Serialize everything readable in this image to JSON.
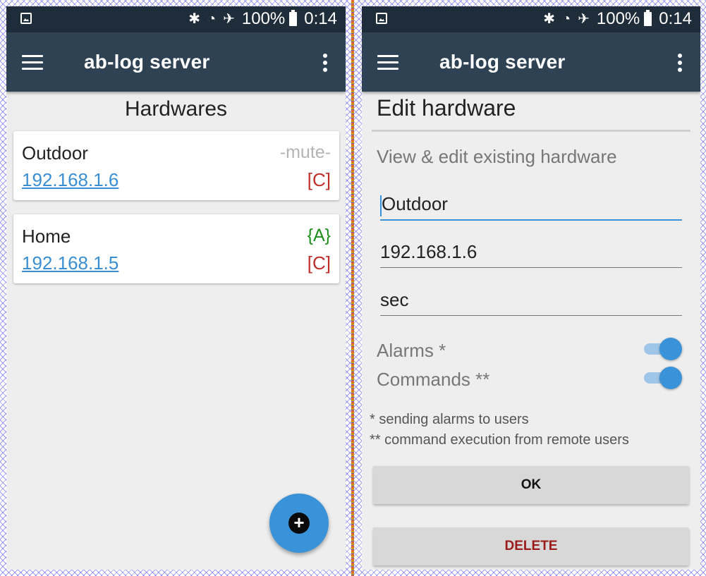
{
  "status_bar": {
    "battery": "100%",
    "time": "0:14"
  },
  "app": {
    "title": "ab-log server"
  },
  "list_screen": {
    "heading": "Hardwares",
    "hardwares": [
      {
        "name": "Outdoor",
        "ip": "192.168.1.6",
        "alarm_state": "-mute-",
        "mode": "[C]"
      },
      {
        "name": "Home",
        "ip": "192.168.1.5",
        "alarm_state": "{A}",
        "mode": "[C]"
      }
    ]
  },
  "edit_screen": {
    "title": "Edit hardware",
    "subtitle": "View & edit existing hardware",
    "fields": {
      "name": "Outdoor",
      "ip": "192.168.1.6",
      "password": "sec"
    },
    "switches": {
      "alarms_label": "Alarms *",
      "alarms_on": true,
      "commands_label": "Commands **",
      "commands_on": true
    },
    "notes": [
      "* sending alarms to users",
      "** command execution from remote users"
    ],
    "ok_label": "OK",
    "delete_label": "DELETE"
  },
  "colors": {
    "appbar": "#2f4253",
    "statusbar": "#1f2c39",
    "accent": "#3a93d8",
    "danger": "#9b1a1a",
    "alarm_active": "#1e8f1e"
  }
}
